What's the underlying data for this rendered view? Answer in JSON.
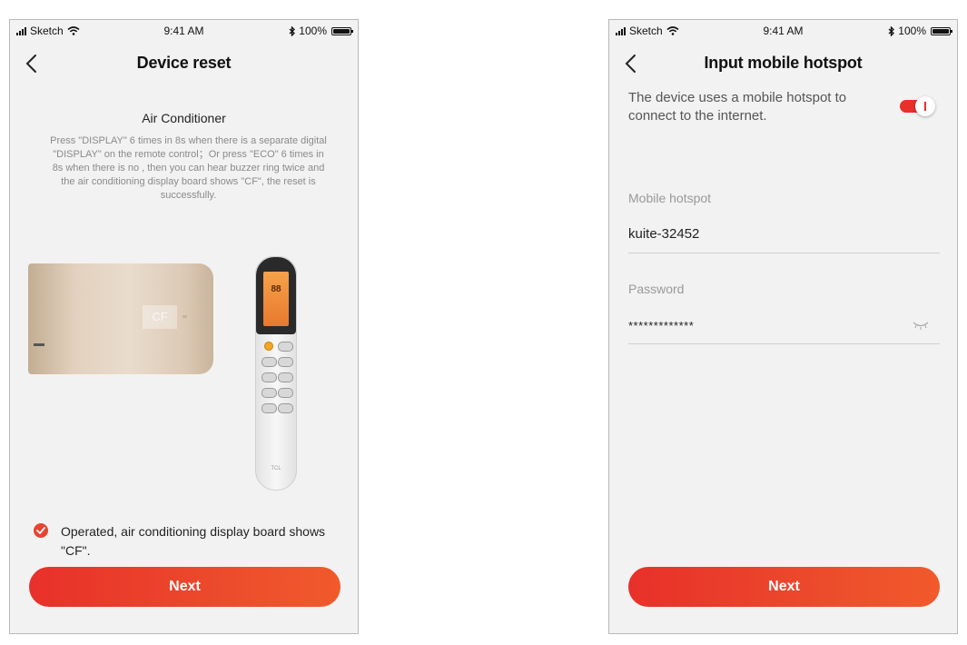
{
  "status_bar": {
    "carrier": "Sketch",
    "time": "9:41 AM",
    "battery": "100%"
  },
  "device_reset_screen": {
    "title": "Device reset",
    "section_heading": "Air Conditioner",
    "instructions": "Press \"DISPLAY\" 6 times in 8s when there is a  separate digital \"DISPLAY\" on the remote control；Or press \"ECO\" 6 times in 8s when there is no  , then you can  hear buzzer ring twice and the air conditioning display board shows \"CF\", the reset is successfully.",
    "ac_display_code": "CF",
    "remote_screen_text": "88",
    "remote_brand": "TCL",
    "confirm_text": "Operated, air conditioning display board shows \"CF\".",
    "confirm_checked": true,
    "next_label": "Next"
  },
  "hotspot_screen": {
    "title": "Input mobile hotspot",
    "description": "The device uses a mobile hotspot to connect to the internet.",
    "toggle_on": true,
    "hotspot_label": "Mobile hotspot",
    "hotspot_value": "kuite-32452",
    "password_label": "Password",
    "password_value": "*************",
    "next_label": "Next"
  },
  "colors": {
    "accent": "#e8302a",
    "accent_end": "#f15a2b",
    "screen_bg": "#f2f2f2",
    "muted_text": "#8a8a8a"
  },
  "icons": [
    "signal-icon",
    "wifi-icon",
    "bluetooth-icon",
    "battery-icon",
    "back-chevron-icon",
    "check-circle-icon",
    "toggle-switch",
    "eye-closed-icon"
  ]
}
